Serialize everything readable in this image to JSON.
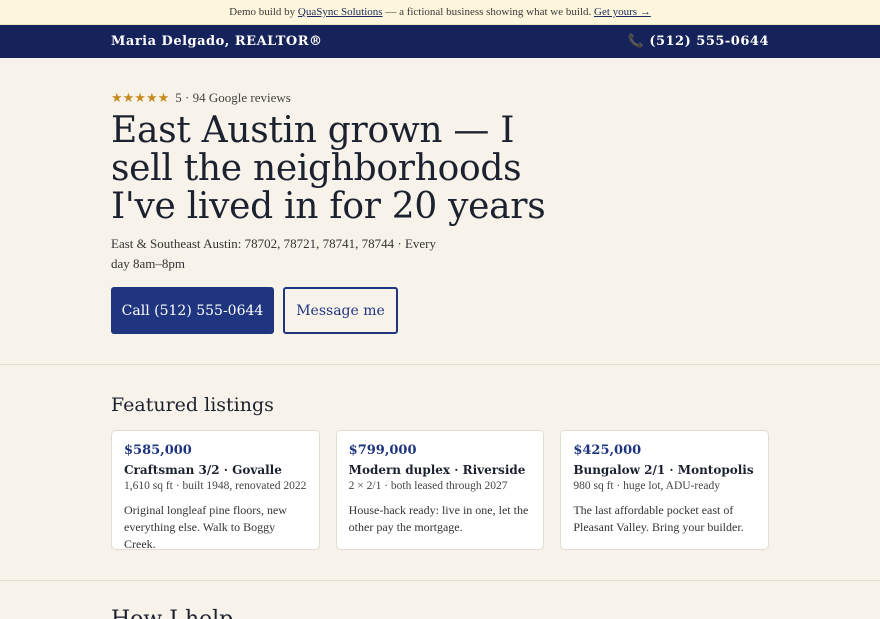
{
  "demo_banner": {
    "prefix": "Demo build by ",
    "company": "QuaSync Solutions",
    "middle": " — a fictional business showing what we build. ",
    "cta": "Get yours →"
  },
  "nav": {
    "name": "Maria Delgado, REALTOR®",
    "phone_icon": "📞",
    "phone": "(512) 555-0644"
  },
  "hero": {
    "stars": "★★★★★",
    "reviews_text": "5 · 94 Google reviews",
    "headline": "East Austin grown — I sell the neighborhoods I've lived in for 20 years",
    "service_area": "East & Southeast Austin: 78702, 78721, 78741, 78744 · Every day 8am–8pm",
    "call_label": "Call (512) 555-0644",
    "message_label": "Message me"
  },
  "listings": {
    "heading": "Featured listings",
    "items": [
      {
        "price": "$585,000",
        "title": "Craftsman 3/2 · Govalle",
        "meta": "1,610 sq ft · built 1948, renovated 2022",
        "desc": "Original longleaf pine floors, new everything else. Walk to Boggy Creek."
      },
      {
        "price": "$799,000",
        "title": "Modern duplex · Riverside",
        "meta": "2 × 2/1 · both leased through 2027",
        "desc": "House-hack ready: live in one, let the other pay the mortgage."
      },
      {
        "price": "$425,000",
        "title": "Bungalow 2/1 · Montopolis",
        "meta": "980 sq ft · huge lot, ADU-ready",
        "desc": "The last affordable pocket east of Pleasant Valley. Bring your builder."
      }
    ]
  },
  "next_section": {
    "heading_partial": "How I help"
  }
}
